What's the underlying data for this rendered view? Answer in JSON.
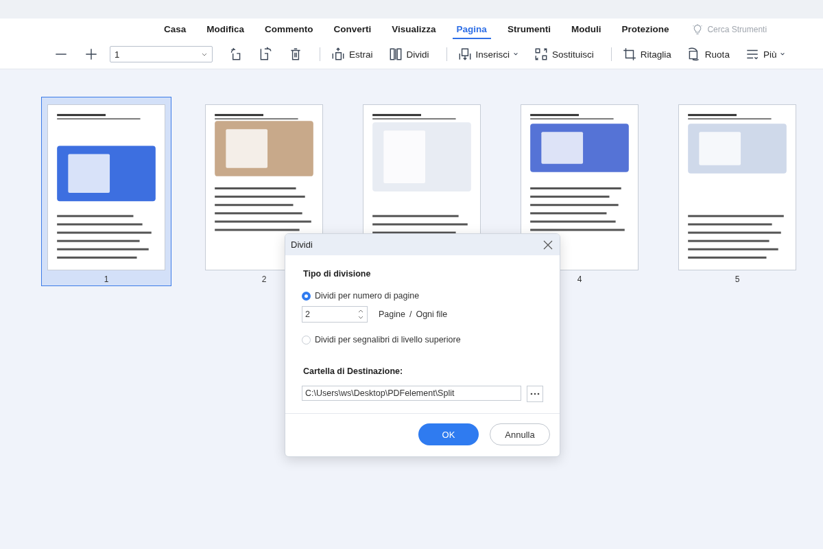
{
  "tabs": [
    {
      "label": "Casa",
      "selected": false
    },
    {
      "label": "Modifica",
      "selected": false
    },
    {
      "label": "Commento",
      "selected": false
    },
    {
      "label": "Converti",
      "selected": false
    },
    {
      "label": "Visualizza",
      "selected": false
    },
    {
      "label": "Pagina",
      "selected": true
    },
    {
      "label": "Strumenti",
      "selected": false
    },
    {
      "label": "Moduli",
      "selected": false
    },
    {
      "label": "Protezione",
      "selected": false
    }
  ],
  "search": {
    "placeholder": "Cerca Strumenti"
  },
  "toolbar": [
    {
      "kind": "icon"
    },
    {
      "kind": "icon"
    },
    {
      "kind": "select",
      "value": "1"
    },
    {
      "kind": "icon"
    },
    {
      "kind": "icon"
    },
    {
      "kind": "icon"
    },
    {
      "kind": "separator"
    },
    {
      "kind": "button",
      "label": "Estrai",
      "menu": false
    },
    {
      "kind": "button",
      "label": "Dividi",
      "menu": false
    },
    {
      "kind": "separator"
    },
    {
      "kind": "button",
      "label": "Inserisci",
      "menu": true
    },
    {
      "kind": "button",
      "label": "Sostituisci",
      "menu": false
    },
    {
      "kind": "separator"
    },
    {
      "kind": "button",
      "label": "Ritaglia",
      "menu": false
    },
    {
      "kind": "button",
      "label": "Ruota",
      "menu": false
    },
    {
      "kind": "button",
      "label": "Più",
      "menu": true
    }
  ],
  "pages": [
    {
      "number": "1",
      "selected": true
    },
    {
      "number": "2",
      "selected": false
    },
    {
      "selected": false
    },
    {
      "number": "4",
      "selected": false
    },
    {
      "number": "5",
      "selected": false
    }
  ],
  "dialog": {
    "title": "Dividi",
    "section_title": "Tipo di divisione",
    "options": [
      {
        "label": "Dividi per numero di pagine",
        "selected": true
      },
      {
        "label": "Dividi per segnalibri di livello superiore",
        "selected": false
      }
    ],
    "pages_value": "2",
    "pages_unit": "Pagine",
    "pages_sep": "/",
    "pages_per": "Ogni file",
    "destination_label": "Cartella di Destinazione:",
    "destination_value": "C:\\Users\\ws\\Desktop\\PDFelement\\Split",
    "ok": "OK",
    "cancel": "Annulla"
  }
}
